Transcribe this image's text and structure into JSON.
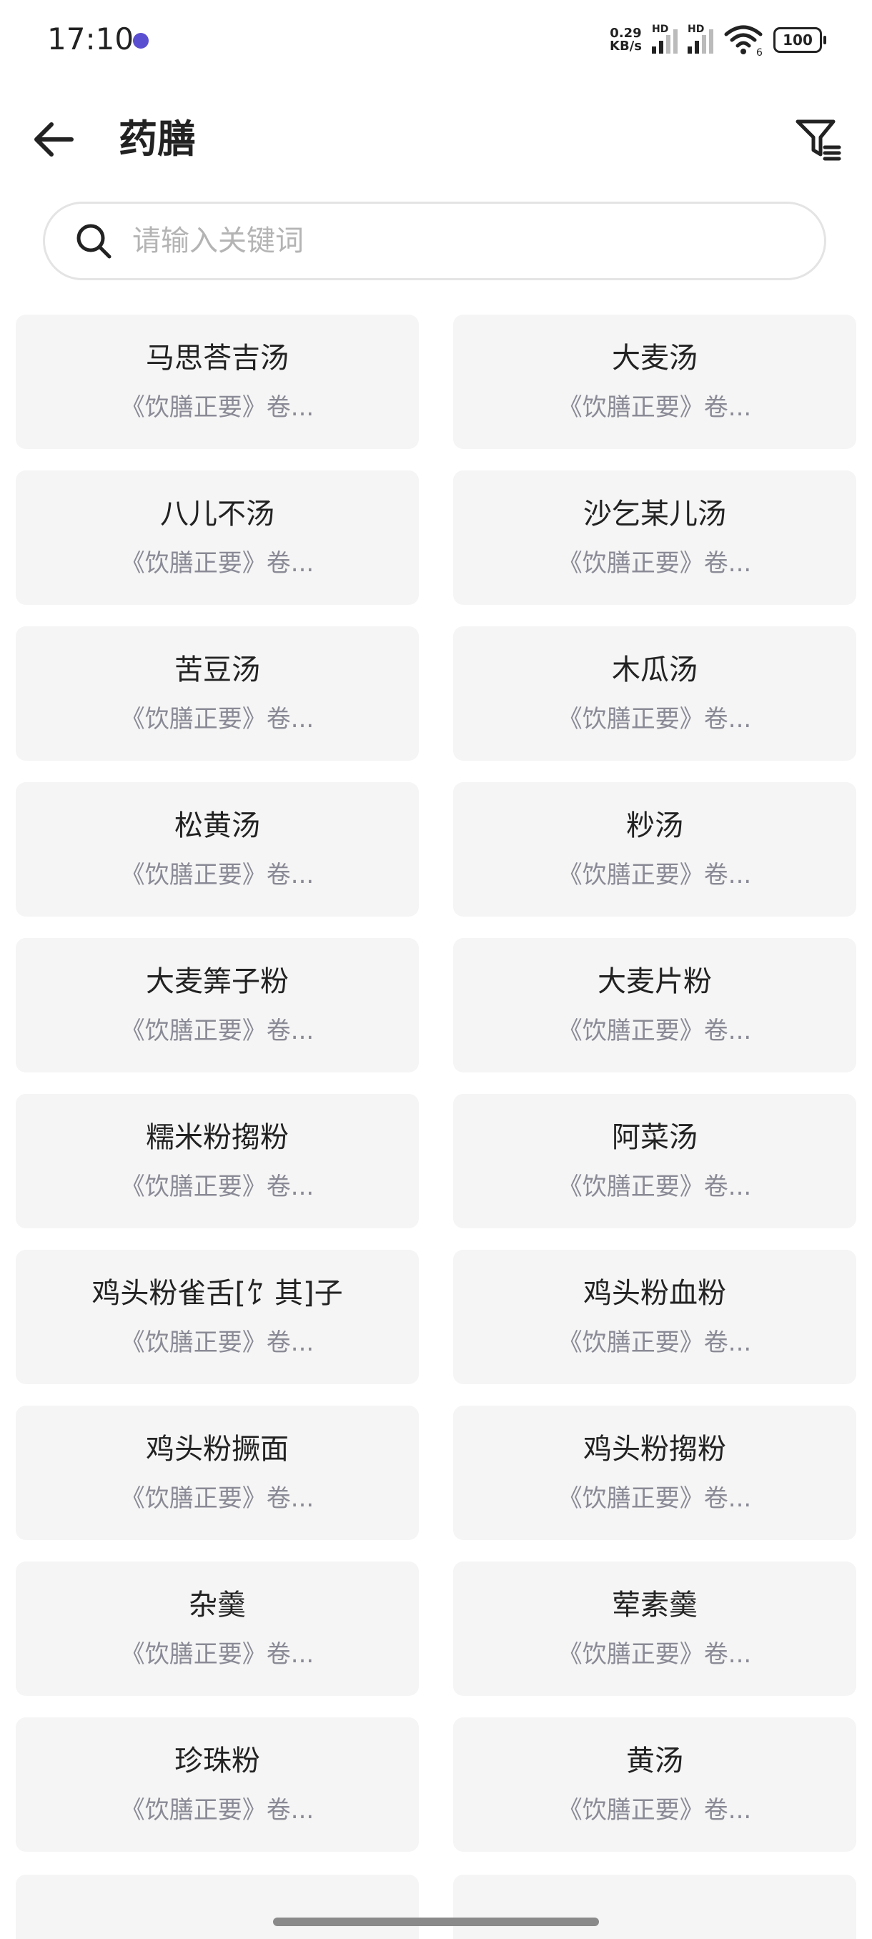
{
  "status_bar": {
    "time": "17:10",
    "net_speed_value": "0.29",
    "net_speed_unit": "KB/s",
    "hd_label": "HD",
    "battery": "100",
    "wifi_label": "6"
  },
  "header": {
    "title": "药膳"
  },
  "search": {
    "placeholder": "请输入关键词"
  },
  "items": [
    {
      "title": "马思荅吉汤",
      "source": "《饮膳正要》卷..."
    },
    {
      "title": "大麦汤",
      "source": "《饮膳正要》卷..."
    },
    {
      "title": "八儿不汤",
      "source": "《饮膳正要》卷..."
    },
    {
      "title": "沙乞某儿汤",
      "source": "《饮膳正要》卷..."
    },
    {
      "title": "苦豆汤",
      "source": "《饮膳正要》卷..."
    },
    {
      "title": "木瓜汤",
      "source": "《饮膳正要》卷..."
    },
    {
      "title": "松黄汤",
      "source": "《饮膳正要》卷..."
    },
    {
      "title": "粆汤",
      "source": "《饮膳正要》卷..."
    },
    {
      "title": "大麦筭子粉",
      "source": "《饮膳正要》卷..."
    },
    {
      "title": "大麦片粉",
      "source": "《饮膳正要》卷..."
    },
    {
      "title": "糯米粉搊粉",
      "source": "《饮膳正要》卷..."
    },
    {
      "title": "阿菜汤",
      "source": "《饮膳正要》卷..."
    },
    {
      "title": "鸡头粉雀舌[饣其]子",
      "source": "《饮膳正要》卷..."
    },
    {
      "title": "鸡头粉血粉",
      "source": "《饮膳正要》卷..."
    },
    {
      "title": "鸡头粉撅面",
      "source": "《饮膳正要》卷..."
    },
    {
      "title": "鸡头粉搊粉",
      "source": "《饮膳正要》卷..."
    },
    {
      "title": "杂羹",
      "source": "《饮膳正要》卷..."
    },
    {
      "title": "荤素羹",
      "source": "《饮膳正要》卷..."
    },
    {
      "title": "珍珠粉",
      "source": "《饮膳正要》卷..."
    },
    {
      "title": "黄汤",
      "source": "《饮膳正要》卷..."
    }
  ]
}
